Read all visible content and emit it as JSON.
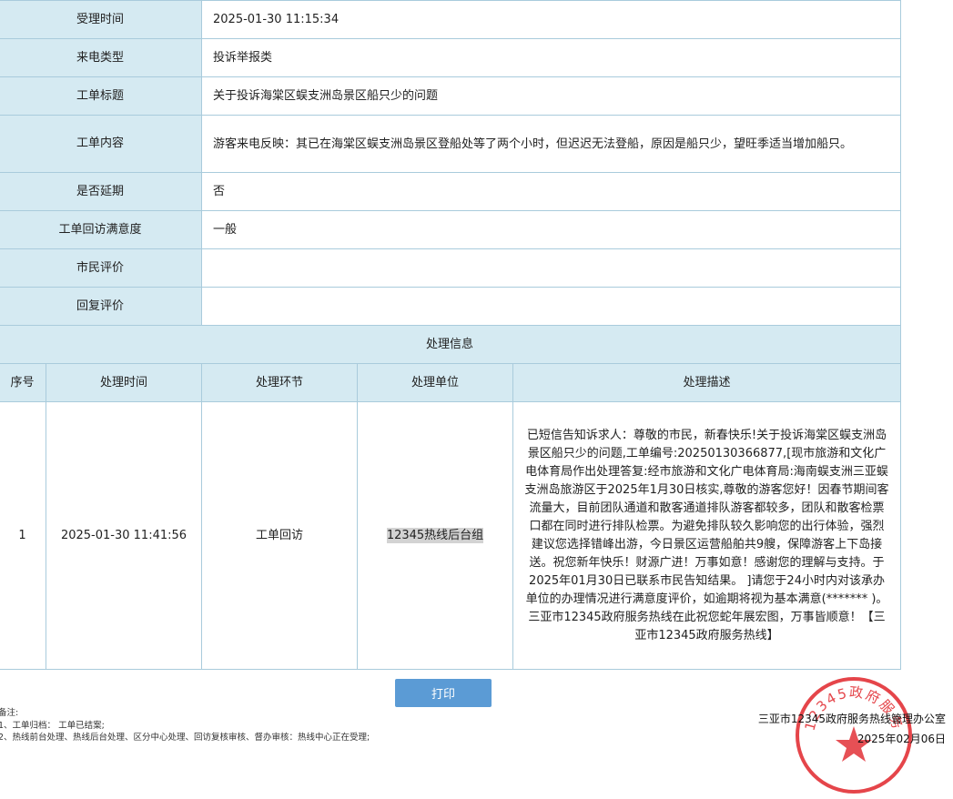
{
  "rows": [
    {
      "label": "受理时间",
      "value": "2025-01-30 11:15:34"
    },
    {
      "label": "来电类型",
      "value": "投诉举报类"
    },
    {
      "label": "工单标题",
      "value": "关于投诉海棠区蜈支洲岛景区船只少的问题"
    },
    {
      "label": "工单内容",
      "value": "游客来电反映：其已在海棠区蜈支洲岛景区登船处等了两个小时，但迟迟无法登船，原因是船只少，望旺季适当增加船只。"
    },
    {
      "label": "是否延期",
      "value": "否"
    },
    {
      "label": "工单回访满意度",
      "value": "一般"
    },
    {
      "label": "市民评价",
      "value": ""
    },
    {
      "label": "回复评价",
      "value": ""
    }
  ],
  "process": {
    "title": "处理信息",
    "headers": [
      "序号",
      "处理时间",
      "处理环节",
      "处理单位",
      "处理描述"
    ],
    "records": [
      {
        "no": "1",
        "time": "2025-01-30 11:41:56",
        "step": "工单回访",
        "unit": "12345热线后台组",
        "desc": "已短信告知诉求人：尊敬的市民，新春快乐!关于投诉海棠区蜈支洲岛景区船只少的问题,工单编号:20250130366877,[现市旅游和文化广电体育局作出处理答复:经市旅游和文化广电体育局:海南蜈支洲三亚蜈支洲岛旅游区于2025年1月30日核实,尊敬的游客您好！因春节期间客流量大，目前团队通道和散客通道排队游客都较多，团队和散客检票口都在同时进行排队检票。为避免排队较久影响您的出行体验，强烈建议您选择错峰出游，今日景区运营船舶共9艘，保障游客上下岛接送。祝您新年快乐！财源广进！万事如意！感谢您的理解与支持。于2025年01月30日已联系市民告知结果。 ]请您于24小时内对该承办单位的办理情况进行满意度评价，如逾期将视为基本满意(******* )。三亚市12345政府服务热线在此祝您蛇年展宏图，万事皆顺意！【三亚市12345政府服务热线】"
      }
    ]
  },
  "print_label": "打印",
  "notes": {
    "heading": "备注:",
    "line1": "1、工单归档：  工单已结案;",
    "line2": "2、热线前台处理、热线后台处理、区分中心处理、回访复核审核、督办审核：热线中心正在受理;"
  },
  "seal": {
    "text": "12345政府服务",
    "color": "#e0242a"
  },
  "office": {
    "name": "三亚市12345政府服务热线管理办公室",
    "date": "2025年02月06日"
  }
}
